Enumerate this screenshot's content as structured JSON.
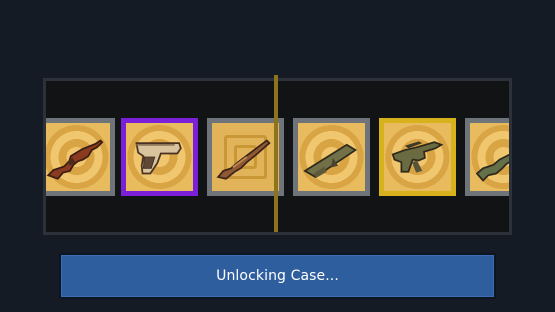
{
  "reel": {
    "items": [
      {
        "weapon": "assault-rifle",
        "rarity": "common",
        "background": "rings"
      },
      {
        "weapon": "pistol",
        "rarity": "purple",
        "background": "rings"
      },
      {
        "weapon": "shotgun",
        "rarity": "common",
        "background": "squares"
      },
      {
        "weapon": "rocket-launcher",
        "rarity": "common",
        "background": "rings"
      },
      {
        "weapon": "sniper-smg",
        "rarity": "gold",
        "background": "rings"
      },
      {
        "weapon": "assault-rifle",
        "rarity": "common",
        "background": "rings"
      }
    ]
  },
  "status": {
    "label": "Unlocking Case..."
  },
  "colors": {
    "background": "#141b25",
    "frame": "#2d323a",
    "reel": "#121315",
    "marker": "#8b7419",
    "common": "#6f737a",
    "purple": "#7c1fd8",
    "gold": "#d8b21c",
    "button": "#2e5e9e"
  }
}
